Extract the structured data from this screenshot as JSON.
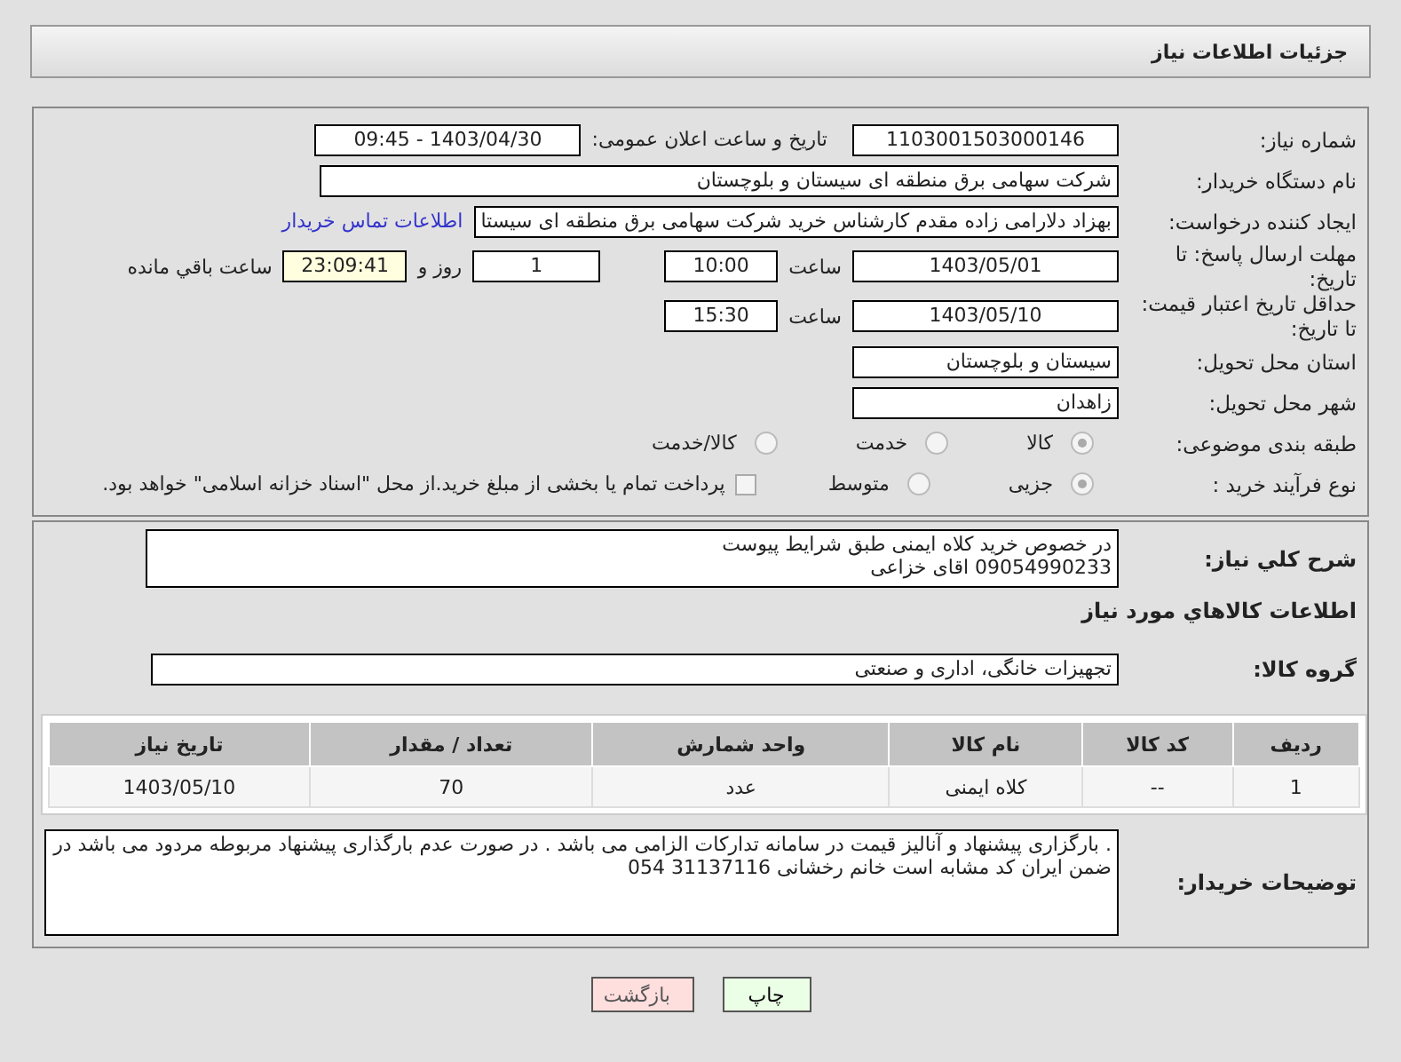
{
  "header": {
    "title": "جزئیات اطلاعات نیاز"
  },
  "need_number": {
    "label": "شماره نیاز:",
    "value": "1103001503000146"
  },
  "announce": {
    "label": "تاریخ و ساعت اعلان عمومی:",
    "value": "1403/04/30 - 09:45"
  },
  "buyer": {
    "label": "نام دستگاه خریدار:",
    "value": "شرکت سهامی برق منطقه ای سیستان و بلوچستان"
  },
  "requester": {
    "label": "ایجاد کننده درخواست:",
    "value": "بهزاد  دلارامی زاده مقدم کارشناس خرید شرکت سهامی برق منطقه ای سیستا",
    "link": "اطلاعات تماس خریدار"
  },
  "deadline": {
    "label": "مهلت ارسال پاسخ: تا تاریخ:",
    "date": "1403/05/01",
    "time_label": "ساعت",
    "time": "10:00",
    "days": "1",
    "days_label": "روز و",
    "remaining": "23:09:41",
    "remaining_label": "ساعت باقي مانده"
  },
  "validity": {
    "label": "حداقل تاریخ اعتبار قیمت: تا تاریخ:",
    "date": "1403/05/10",
    "time_label": "ساعت",
    "time": "15:30"
  },
  "province": {
    "label": "استان محل تحویل:",
    "value": "سیستان و بلوچستان"
  },
  "city": {
    "label": "شهر محل تحویل:",
    "value": "زاهدان"
  },
  "category": {
    "label": "طبقه بندی موضوعی:",
    "options": [
      {
        "label": "کالا",
        "selected": true
      },
      {
        "label": "خدمت",
        "selected": false
      },
      {
        "label": "کالا/خدمت",
        "selected": false
      }
    ]
  },
  "process": {
    "label": "نوع فرآیند خرید :",
    "options": [
      {
        "label": "جزیی",
        "selected": true
      },
      {
        "label": "متوسط",
        "selected": false
      }
    ],
    "treasury": {
      "label": "پرداخت تمام یا بخشی از مبلغ خرید.از محل \"اسناد خزانه اسلامی\" خواهد بود.",
      "checked": false
    }
  },
  "description": {
    "label": "شرح کلي نياز:",
    "lines": [
      "در خصوص خرید کلاه ایمنی طبق شرایط پیوست",
      "09054990233 اقای خزاعی"
    ]
  },
  "goods_title": "اطلاعات کالاهاي مورد نياز",
  "goods_group": {
    "label": "گروه کالا:",
    "value": "تجهیزات خانگی، اداری و صنعتی"
  },
  "table": {
    "columns": [
      "ردیف",
      "کد کالا",
      "نام کالا",
      "واحد شمارش",
      "تعداد / مقدار",
      "تاریخ نیاز"
    ],
    "rows": [
      [
        "1",
        "--",
        "کلاه ایمنی",
        "عدد",
        "70",
        "1403/05/10"
      ]
    ]
  },
  "buyer_notes": {
    "label": "توضیحات خریدار:",
    "lines": [
      ". بارگزاری پیشنهاد و آنالیز قیمت در سامانه تدارکات الزامی می باشد . در صورت عدم بارگذاری پیشنهاد مربوطه مردود می باشد در ضمن ایران کد مشابه است خانم رخشانی 31137116 054"
    ]
  },
  "buttons": [
    {
      "label": "چاپ",
      "kind": "print"
    },
    {
      "label": "بازگشت",
      "kind": "back"
    }
  ]
}
